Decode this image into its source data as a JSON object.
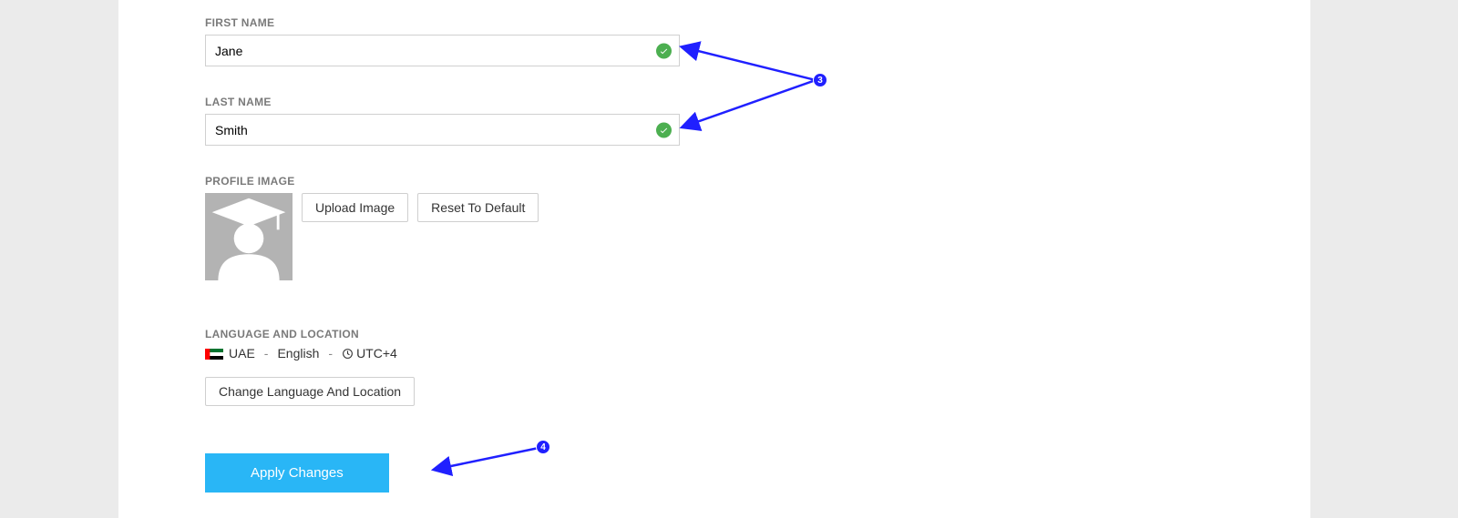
{
  "fields": {
    "first_name": {
      "label": "FIRST NAME",
      "value": "Jane"
    },
    "last_name": {
      "label": "LAST NAME",
      "value": "Smith"
    }
  },
  "profile_image": {
    "label": "PROFILE IMAGE",
    "upload_label": "Upload Image",
    "reset_label": "Reset To Default"
  },
  "lang_loc": {
    "label": "LANGUAGE AND LOCATION",
    "country": "UAE",
    "language": "English",
    "timezone": "UTC+4",
    "change_label": "Change Language And Location"
  },
  "apply_label": "Apply Changes",
  "annotations": {
    "badge3": "3",
    "badge4": "4"
  }
}
